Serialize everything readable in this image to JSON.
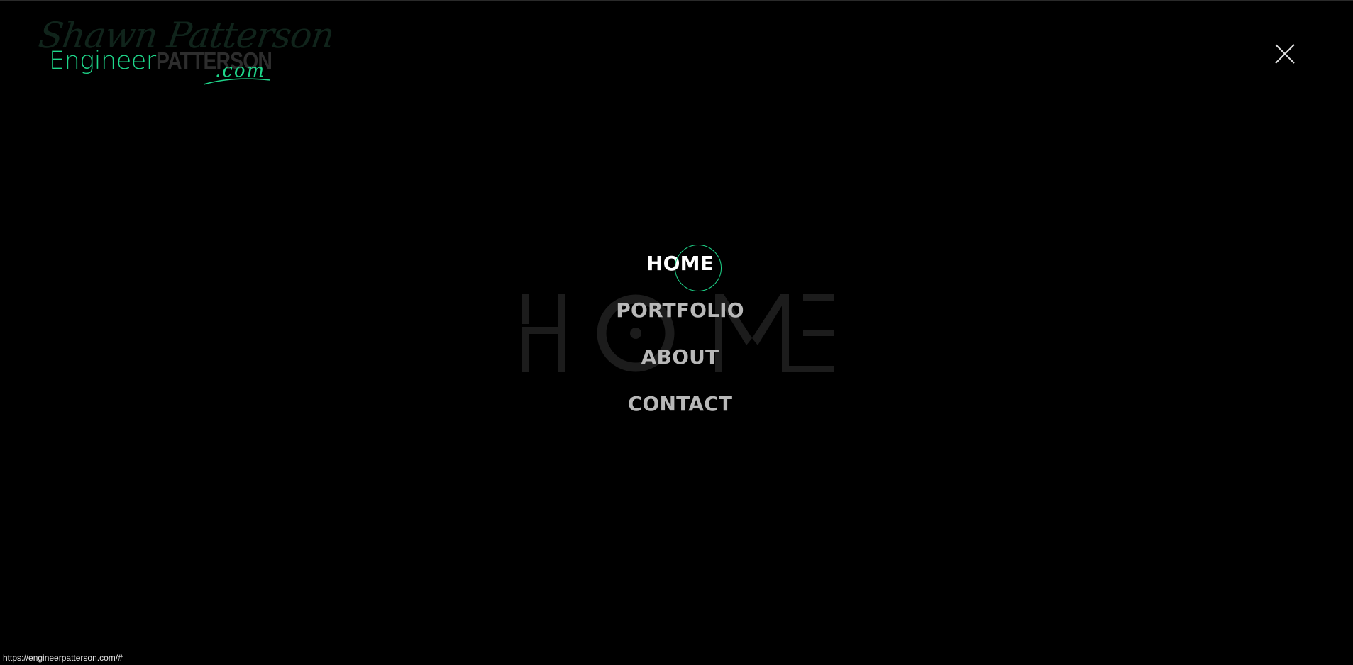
{
  "logo": {
    "script_text": "Shawn Patterson",
    "engineer": "Engineer",
    "patterson": "PATTERSON",
    "dotcom": ".com"
  },
  "menu": {
    "items": [
      {
        "label": "HOME",
        "active": true
      },
      {
        "label": "PORTFOLIO",
        "active": false
      },
      {
        "label": "ABOUT",
        "active": false
      },
      {
        "label": "CONTACT",
        "active": false
      }
    ]
  },
  "status_bar": {
    "url": "https://engineerpatterson.com/#"
  },
  "colors": {
    "background": "#000000",
    "accent": "#1ed68a",
    "menu_active": "#ffffff",
    "menu_inactive": "#b8b8b8",
    "watermark": "#1c1c1c"
  },
  "icons": {
    "close": "close-icon"
  }
}
